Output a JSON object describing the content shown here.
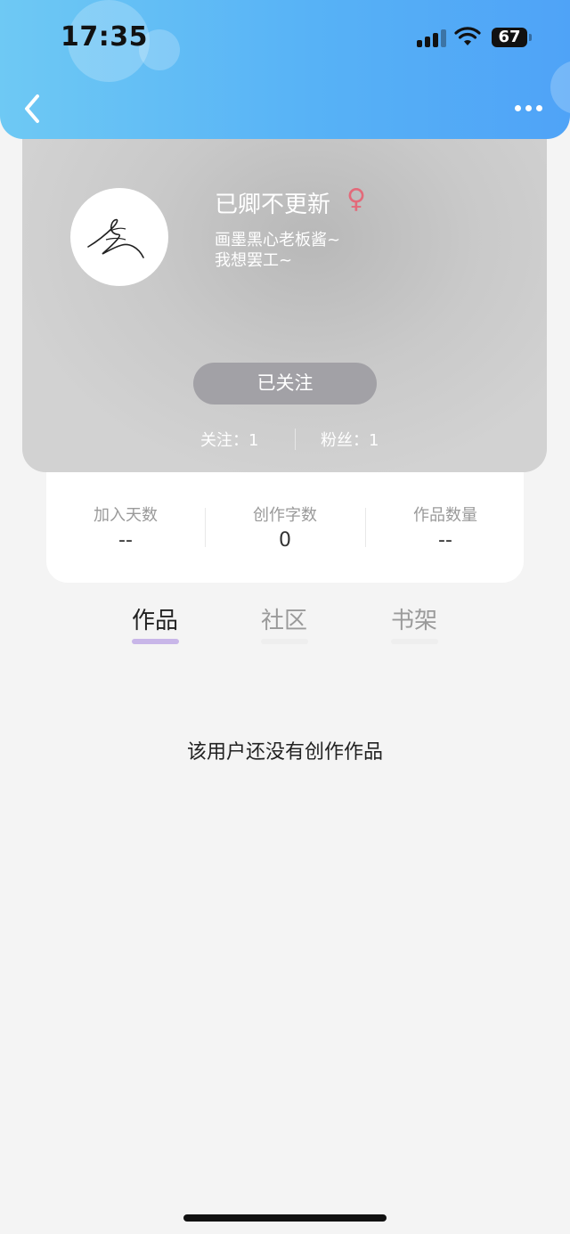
{
  "status_bar": {
    "time": "17:35",
    "battery": "67"
  },
  "header": {
    "back_icon": "chevron-left-icon",
    "more_icon": "more-dots-icon"
  },
  "profile": {
    "username": "已卿不更新",
    "gender_symbol": "♀",
    "bio_line1": "画墨黑心老板酱~",
    "bio_line2": "我想罢工~",
    "follow_button": "已关注",
    "following": "关注：1",
    "fans": "粉丝：1",
    "gender_color": "#e36a7a"
  },
  "stats": [
    {
      "label": "加入天数",
      "value": "--"
    },
    {
      "label": "创作字数",
      "value": "0"
    },
    {
      "label": "作品数量",
      "value": "--"
    }
  ],
  "tabs": [
    {
      "label": "作品",
      "active": true
    },
    {
      "label": "社区",
      "active": false
    },
    {
      "label": "书架",
      "active": false
    }
  ],
  "empty_message": "该用户还没有创作作品",
  "colors": {
    "header_start": "#6ec9f4",
    "header_end": "#4fa3f7",
    "tab_active_indicator": "#c8b6e8"
  }
}
